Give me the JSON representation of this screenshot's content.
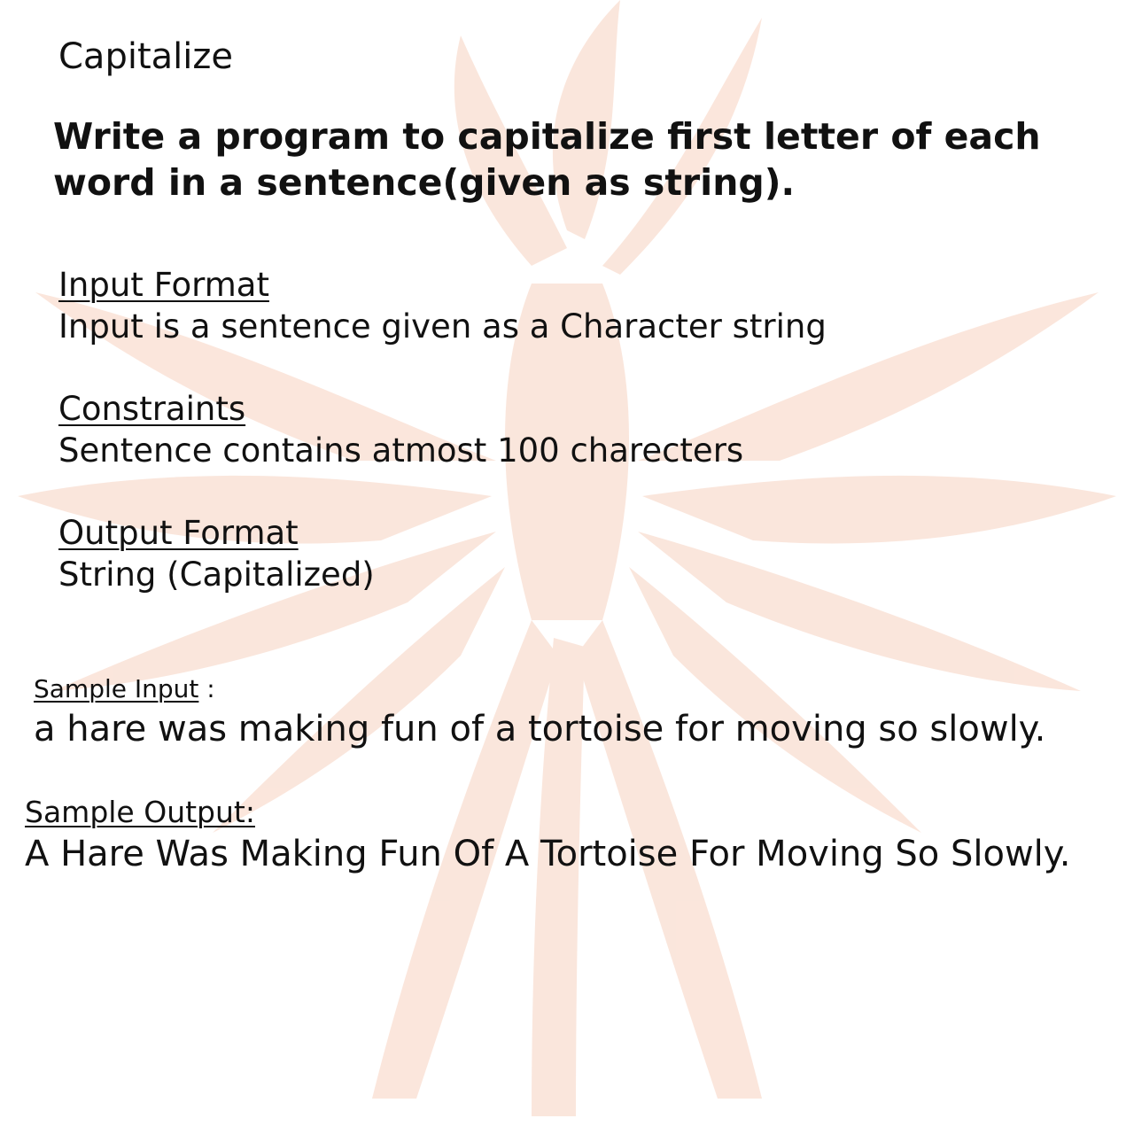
{
  "title": "Capitalize",
  "problem_statement": "Write a program to capitalize first letter of each word in a sentence(given as string).",
  "sections": [
    {
      "heading": "Input Format",
      "body": "Input is a sentence given as a Character string"
    },
    {
      "heading": "Constraints",
      "body": "Sentence contains atmost 100 charecters"
    },
    {
      "heading": "Output Format",
      "body": "String (Capitalized)"
    }
  ],
  "sample_input": {
    "heading": "Sample Input",
    "separator": " :",
    "value": "a hare was making fun of a tortoise for moving so slowly."
  },
  "sample_output": {
    "heading": "Sample Output:",
    "value": "A Hare Was Making Fun Of A Tortoise For Moving So Slowly."
  },
  "watermark": {
    "icon": "phoenix-logo-icon",
    "color": "#f7d2c0"
  }
}
